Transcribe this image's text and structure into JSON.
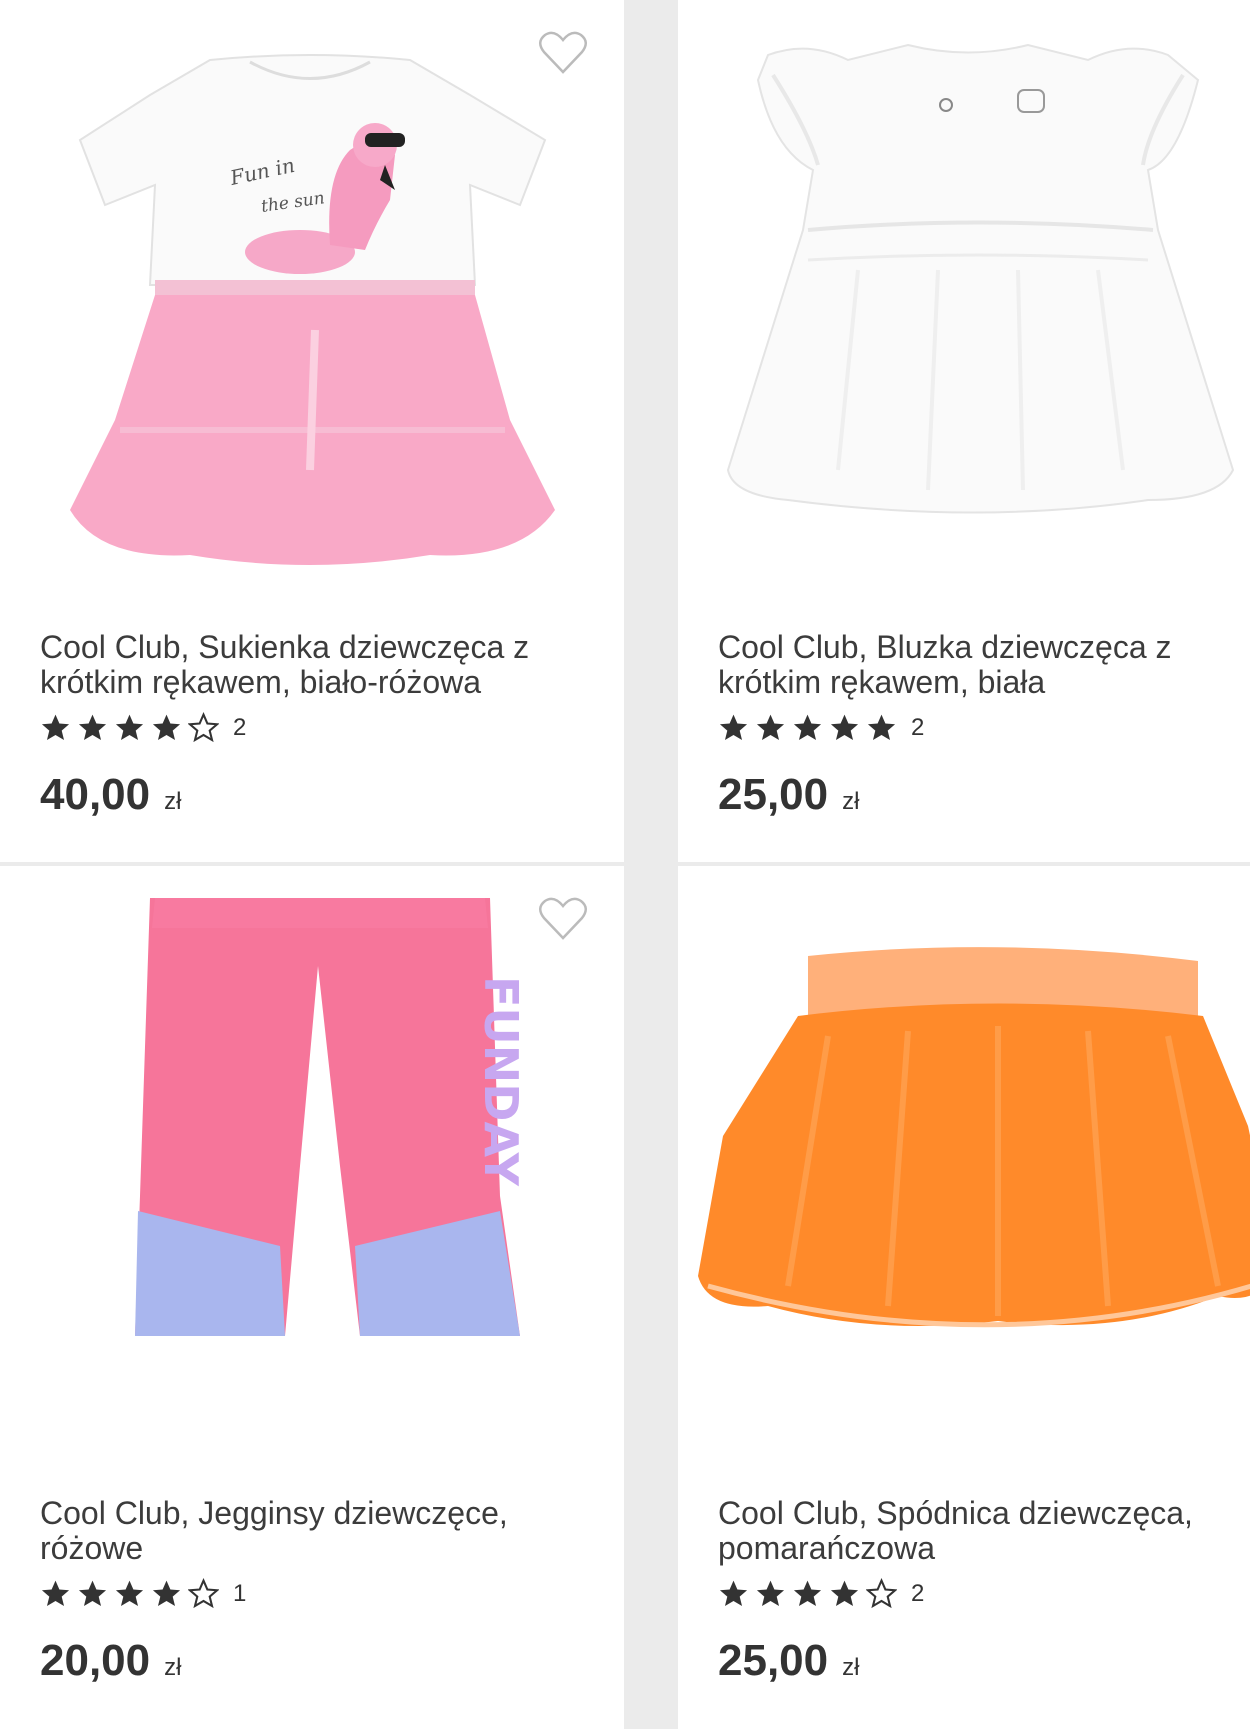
{
  "currency": "zł",
  "products": [
    {
      "title": "Cool Club, Sukienka dziewczęca z krótkim rękawem, biało-różowa",
      "stars": 4,
      "rating_count": "2",
      "price": "40,00",
      "image_icon": "flamingo-dress-image",
      "print_text": [
        "Fun in",
        "the sun"
      ]
    },
    {
      "title": "Cool Club, Bluzka dziewczęca z krótkim rękawem, biała",
      "stars": 5,
      "rating_count": "2",
      "price": "25,00",
      "image_icon": "white-blouse-image"
    },
    {
      "title": "Cool Club, Jegginsy dziewczęce, różowe",
      "stars": 4,
      "rating_count": "1",
      "price": "20,00",
      "image_icon": "pink-jeggings-image",
      "print_text": "FUNDAY"
    },
    {
      "title": "Cool Club, Spódnica dziewczęca, pomarańczowa",
      "stars": 4,
      "rating_count": "2",
      "price": "25,00",
      "image_icon": "orange-skirt-image"
    }
  ],
  "colors": {
    "star": "#333333",
    "pink": "#f47ea6",
    "orange": "#ff8a2a"
  },
  "icons": {
    "favorite": "heart-outline-icon",
    "star_full": "star-filled-icon",
    "star_empty": "star-outline-icon"
  }
}
